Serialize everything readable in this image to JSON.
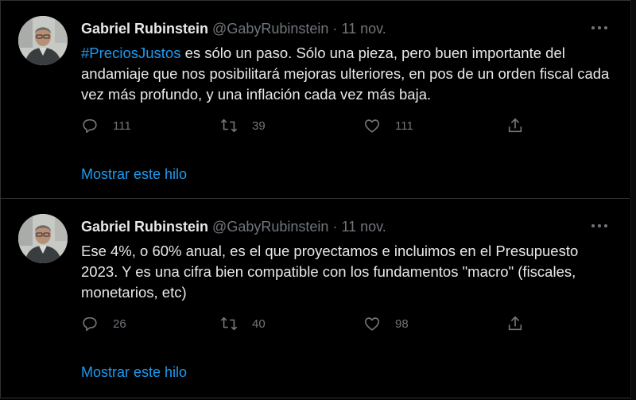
{
  "tweets": [
    {
      "author": {
        "name": "Gabriel Rubinstein",
        "handle": "@GabyRubinstein",
        "separator": "·",
        "date": "11 nov."
      },
      "hashtag": "#PreciosJustos",
      "text": " es sólo un paso. Sólo una pieza,  pero buen importante del andamiaje que nos posibilitará mejoras ulteriores, en pos de un orden fiscal cada vez más profundo, y una inflación cada vez más baja.",
      "counts": {
        "replies": "111",
        "retweets": "39",
        "likes": "111"
      },
      "show_thread": "Mostrar este hilo"
    },
    {
      "author": {
        "name": "Gabriel Rubinstein",
        "handle": "@GabyRubinstein",
        "separator": "·",
        "date": "11 nov."
      },
      "hashtag": "",
      "text": "Ese 4%, o 60% anual, es el que proyectamos e incluimos en el Presupuesto 2023. Y es una cifra bien compatible con los fundamentos \"macro\" (fiscales, monetarios, etc)",
      "counts": {
        "replies": "26",
        "retweets": "40",
        "likes": "98"
      },
      "show_thread": "Mostrar este hilo"
    }
  ],
  "icons": {
    "reply": "reply-icon",
    "retweet": "retweet-icon",
    "like": "like-icon",
    "share": "share-icon",
    "more": "more-options-icon"
  },
  "colors": {
    "background": "#000000",
    "text": "#e7e9ea",
    "muted": "#71767b",
    "accent": "#1d9bf0",
    "divider": "#2f3336"
  }
}
